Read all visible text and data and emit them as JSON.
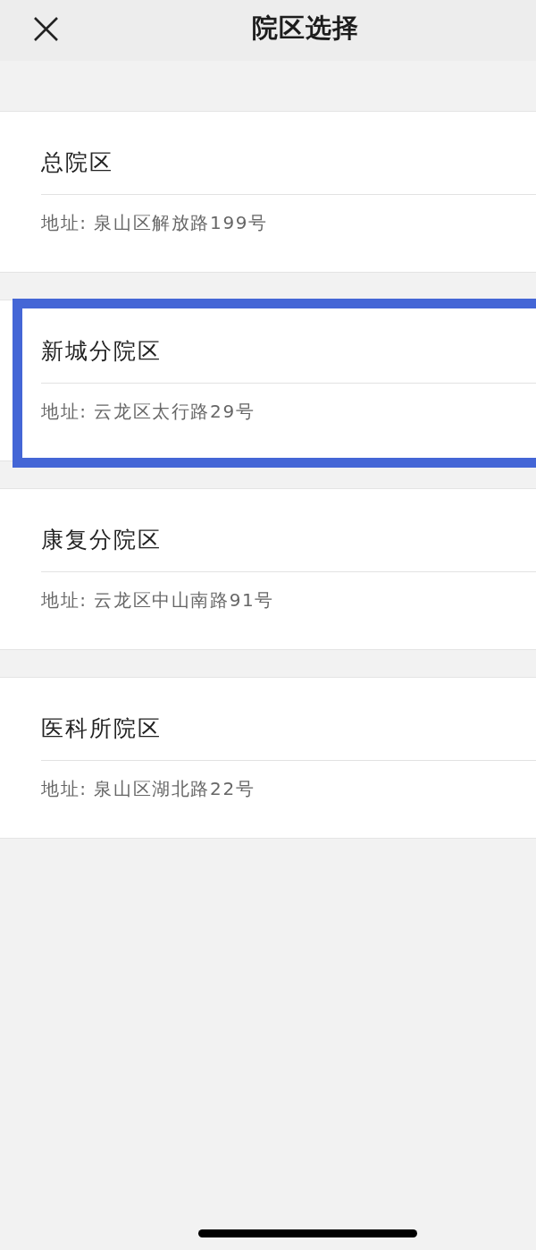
{
  "header": {
    "title": "院区选择"
  },
  "campuses": [
    {
      "name": "总院区",
      "address": "地址: 泉山区解放路199号",
      "selected": false
    },
    {
      "name": "新城分院区",
      "address": "地址: 云龙区太行路29号",
      "selected": true
    },
    {
      "name": "康复分院区",
      "address": "地址: 云龙区中山南路91号",
      "selected": false
    },
    {
      "name": "医科所院区",
      "address": "地址: 泉山区湖北路22号",
      "selected": false
    }
  ]
}
